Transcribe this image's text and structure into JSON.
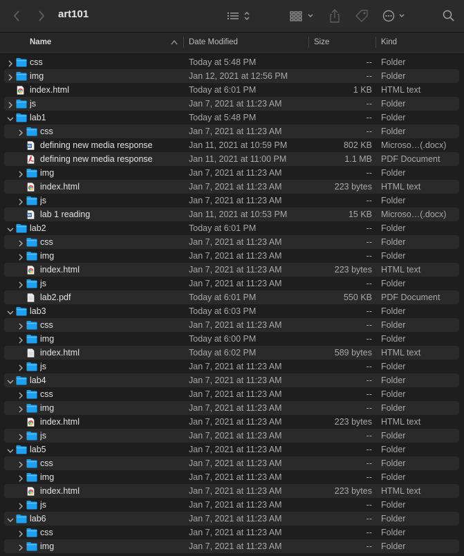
{
  "window": {
    "title": "art101",
    "icons": {
      "back": "chevron-left-icon",
      "forward": "chevron-right-icon",
      "view_list": "list-view-icon",
      "group": "grid-group-icon",
      "share": "share-icon",
      "tag": "tag-icon",
      "action": "ellipsis-circle-icon",
      "search": "search-icon"
    }
  },
  "columns": {
    "name": "Name",
    "date": "Date Modified",
    "size": "Size",
    "kind": "Kind"
  },
  "colors": {
    "folder": "#1ea1f0",
    "background": "#1e1e1e",
    "row_alt": "#2a2a2a"
  },
  "rows": [
    {
      "name": "css",
      "date": "Today at 5:48 PM",
      "size": "--",
      "kind": "Folder",
      "icon": "folder",
      "level": 0,
      "expanded": false
    },
    {
      "name": "img",
      "date": "Jan 12, 2021 at 12:56 PM",
      "size": "--",
      "kind": "Folder",
      "icon": "folder",
      "level": 0,
      "expanded": false
    },
    {
      "name": "index.html",
      "date": "Today at 6:01 PM",
      "size": "1 KB",
      "kind": "HTML text",
      "icon": "chrome",
      "level": 0
    },
    {
      "name": "js",
      "date": "Jan 7, 2021 at 11:23 AM",
      "size": "--",
      "kind": "Folder",
      "icon": "folder",
      "level": 0,
      "expanded": false
    },
    {
      "name": "lab1",
      "date": "Today at 5:48 PM",
      "size": "--",
      "kind": "Folder",
      "icon": "folder",
      "level": 0,
      "expanded": true
    },
    {
      "name": "css",
      "date": "Jan 7, 2021 at 11:23 AM",
      "size": "--",
      "kind": "Folder",
      "icon": "folder",
      "level": 1,
      "expanded": false
    },
    {
      "name": "defining new media response",
      "date": "Jan 11, 2021 at 10:59 PM",
      "size": "802 KB",
      "kind": "Microso…(.docx)",
      "icon": "word",
      "level": 1
    },
    {
      "name": "defining new media response",
      "date": "Jan 11, 2021 at 11:00 PM",
      "size": "1.1 MB",
      "kind": "PDF Document",
      "icon": "pdf",
      "level": 1
    },
    {
      "name": "img",
      "date": "Jan 7, 2021 at 11:23 AM",
      "size": "--",
      "kind": "Folder",
      "icon": "folder",
      "level": 1,
      "expanded": false
    },
    {
      "name": "index.html",
      "date": "Jan 7, 2021 at 11:23 AM",
      "size": "223 bytes",
      "kind": "HTML text",
      "icon": "chrome",
      "level": 1
    },
    {
      "name": "js",
      "date": "Jan 7, 2021 at 11:23 AM",
      "size": "--",
      "kind": "Folder",
      "icon": "folder",
      "level": 1,
      "expanded": false
    },
    {
      "name": "lab 1 reading",
      "date": "Jan 11, 2021 at 10:53 PM",
      "size": "15 KB",
      "kind": "Microso…(.docx)",
      "icon": "word",
      "level": 1
    },
    {
      "name": "lab2",
      "date": "Today at 6:01 PM",
      "size": "--",
      "kind": "Folder",
      "icon": "folder",
      "level": 0,
      "expanded": true
    },
    {
      "name": "css",
      "date": "Jan 7, 2021 at 11:23 AM",
      "size": "--",
      "kind": "Folder",
      "icon": "folder",
      "level": 1,
      "expanded": false
    },
    {
      "name": "img",
      "date": "Jan 7, 2021 at 11:23 AM",
      "size": "--",
      "kind": "Folder",
      "icon": "folder",
      "level": 1,
      "expanded": false
    },
    {
      "name": "index.html",
      "date": "Jan 7, 2021 at 11:23 AM",
      "size": "223 bytes",
      "kind": "HTML text",
      "icon": "chrome",
      "level": 1
    },
    {
      "name": "js",
      "date": "Jan 7, 2021 at 11:23 AM",
      "size": "--",
      "kind": "Folder",
      "icon": "folder",
      "level": 1,
      "expanded": false
    },
    {
      "name": "lab2.pdf",
      "date": "Today at 6:01 PM",
      "size": "550 KB",
      "kind": "PDF Document",
      "icon": "doc",
      "level": 1
    },
    {
      "name": "lab3",
      "date": "Today at 6:03 PM",
      "size": "--",
      "kind": "Folder",
      "icon": "folder",
      "level": 0,
      "expanded": true
    },
    {
      "name": "css",
      "date": "Jan 7, 2021 at 11:23 AM",
      "size": "--",
      "kind": "Folder",
      "icon": "folder",
      "level": 1,
      "expanded": false
    },
    {
      "name": "img",
      "date": "Today at 6:00 PM",
      "size": "--",
      "kind": "Folder",
      "icon": "folder",
      "level": 1,
      "expanded": false
    },
    {
      "name": "index.html",
      "date": "Today at 6:02 PM",
      "size": "589 bytes",
      "kind": "HTML text",
      "icon": "doc",
      "level": 1
    },
    {
      "name": "js",
      "date": "Jan 7, 2021 at 11:23 AM",
      "size": "--",
      "kind": "Folder",
      "icon": "folder",
      "level": 1,
      "expanded": false
    },
    {
      "name": "lab4",
      "date": "Jan 7, 2021 at 11:23 AM",
      "size": "--",
      "kind": "Folder",
      "icon": "folder",
      "level": 0,
      "expanded": true
    },
    {
      "name": "css",
      "date": "Jan 7, 2021 at 11:23 AM",
      "size": "--",
      "kind": "Folder",
      "icon": "folder",
      "level": 1,
      "expanded": false
    },
    {
      "name": "img",
      "date": "Jan 7, 2021 at 11:23 AM",
      "size": "--",
      "kind": "Folder",
      "icon": "folder",
      "level": 1,
      "expanded": false
    },
    {
      "name": "index.html",
      "date": "Jan 7, 2021 at 11:23 AM",
      "size": "223 bytes",
      "kind": "HTML text",
      "icon": "chrome",
      "level": 1
    },
    {
      "name": "js",
      "date": "Jan 7, 2021 at 11:23 AM",
      "size": "--",
      "kind": "Folder",
      "icon": "folder",
      "level": 1,
      "expanded": false
    },
    {
      "name": "lab5",
      "date": "Jan 7, 2021 at 11:23 AM",
      "size": "--",
      "kind": "Folder",
      "icon": "folder",
      "level": 0,
      "expanded": true
    },
    {
      "name": "css",
      "date": "Jan 7, 2021 at 11:23 AM",
      "size": "--",
      "kind": "Folder",
      "icon": "folder",
      "level": 1,
      "expanded": false
    },
    {
      "name": "img",
      "date": "Jan 7, 2021 at 11:23 AM",
      "size": "--",
      "kind": "Folder",
      "icon": "folder",
      "level": 1,
      "expanded": false
    },
    {
      "name": "index.html",
      "date": "Jan 7, 2021 at 11:23 AM",
      "size": "223 bytes",
      "kind": "HTML text",
      "icon": "chrome",
      "level": 1
    },
    {
      "name": "js",
      "date": "Jan 7, 2021 at 11:23 AM",
      "size": "--",
      "kind": "Folder",
      "icon": "folder",
      "level": 1,
      "expanded": false
    },
    {
      "name": "lab6",
      "date": "Jan 7, 2021 at 11:23 AM",
      "size": "--",
      "kind": "Folder",
      "icon": "folder",
      "level": 0,
      "expanded": true
    },
    {
      "name": "css",
      "date": "Jan 7, 2021 at 11:23 AM",
      "size": "--",
      "kind": "Folder",
      "icon": "folder",
      "level": 1,
      "expanded": false
    },
    {
      "name": "img",
      "date": "Jan 7, 2021 at 11:23 AM",
      "size": "--",
      "kind": "Folder",
      "icon": "folder",
      "level": 1,
      "expanded": false
    }
  ]
}
